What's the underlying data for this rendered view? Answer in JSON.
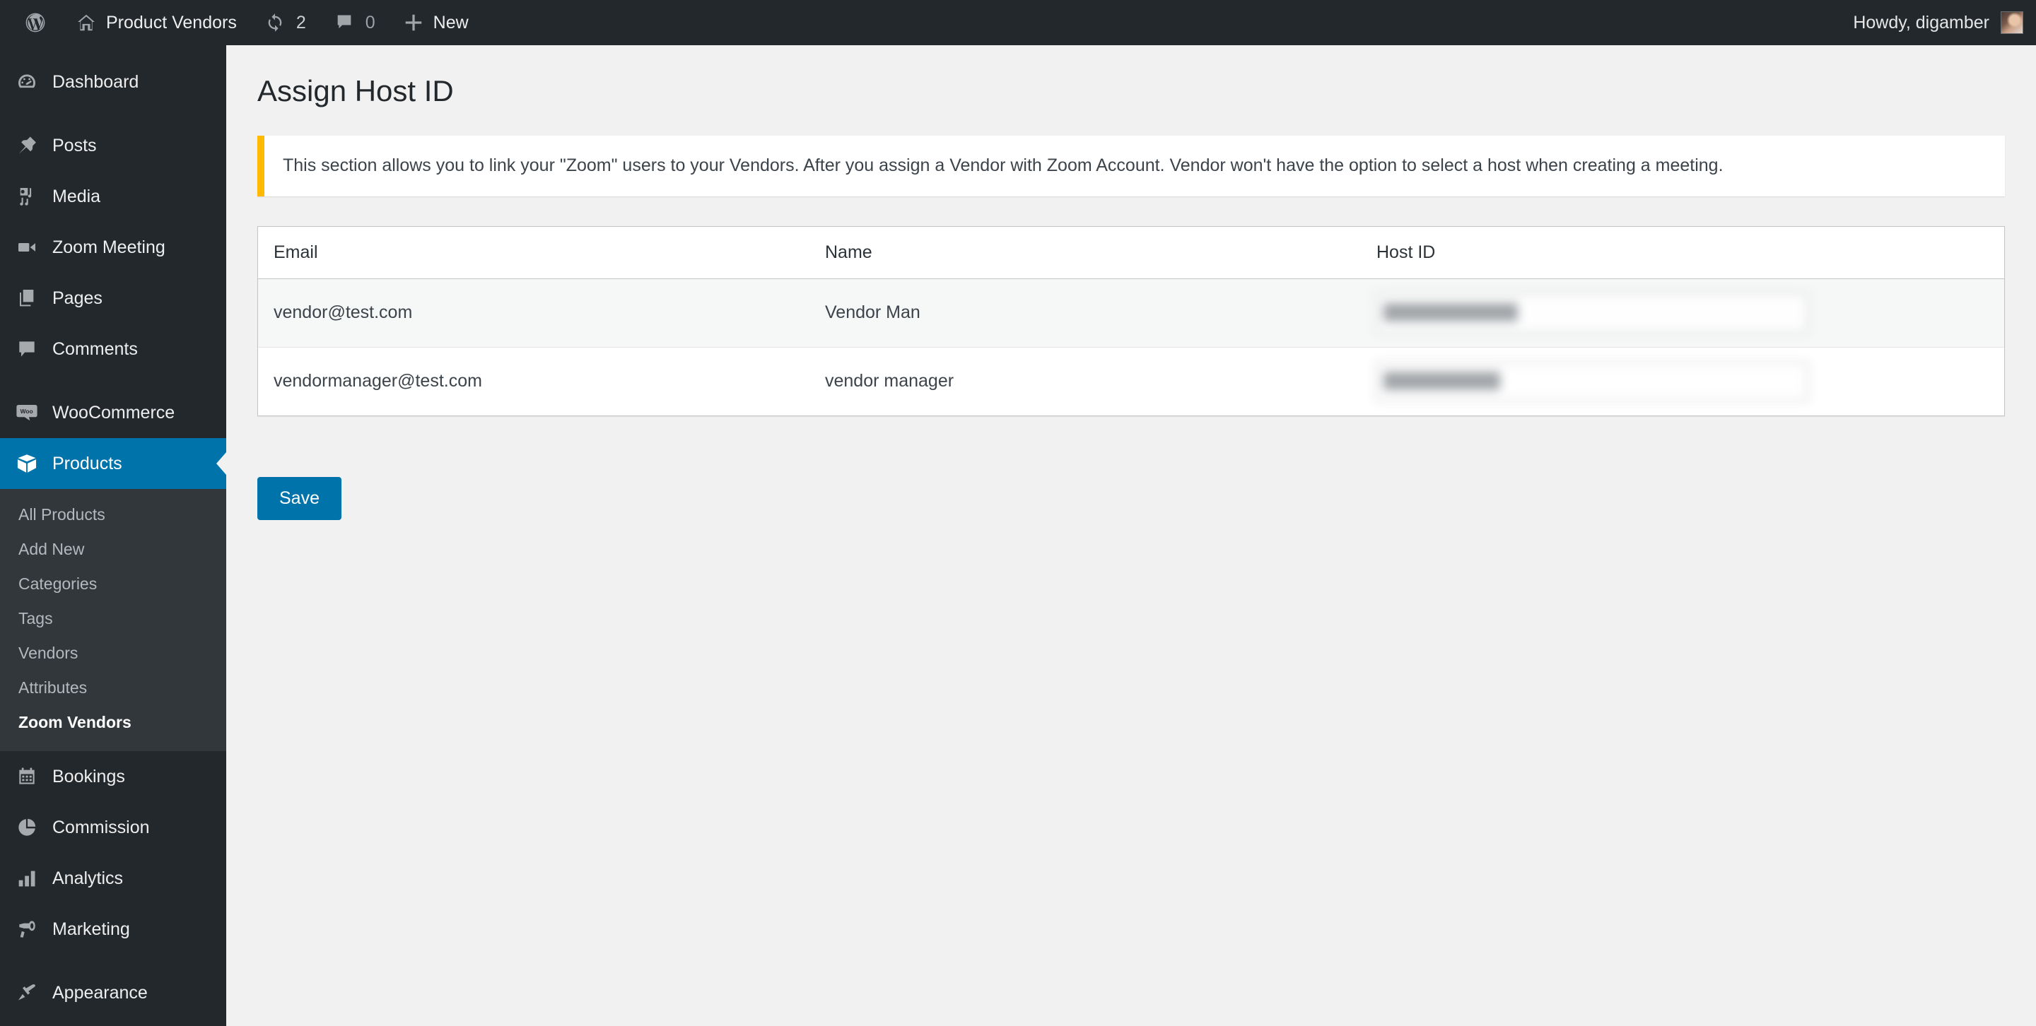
{
  "adminbar": {
    "site_name": "Product Vendors",
    "updates_count": "2",
    "comments_count": "0",
    "new_label": "New",
    "howdy": "Howdy, digamber",
    "icons": {
      "wordpress": "wordpress-logo-icon",
      "home": "home-icon",
      "updates": "updates-icon",
      "comments": "comment-bubble-icon",
      "new": "plus-icon",
      "avatar": "user-avatar"
    }
  },
  "sidebar": {
    "items": [
      {
        "label": "Dashboard",
        "icon": "dashboard-icon",
        "current": false,
        "separator_after": true
      },
      {
        "label": "Posts",
        "icon": "pin-icon",
        "current": false,
        "separator_after": false
      },
      {
        "label": "Media",
        "icon": "media-icon",
        "current": false,
        "separator_after": false
      },
      {
        "label": "Zoom Meeting",
        "icon": "video-camera-icon",
        "current": false,
        "separator_after": false
      },
      {
        "label": "Pages",
        "icon": "pages-icon",
        "current": false,
        "separator_after": false
      },
      {
        "label": "Comments",
        "icon": "comment-bubble-icon",
        "current": false,
        "separator_after": true
      },
      {
        "label": "WooCommerce",
        "icon": "woocommerce-icon",
        "current": false,
        "separator_after": false
      },
      {
        "label": "Products",
        "icon": "products-box-icon",
        "current": true,
        "separator_after": false
      }
    ],
    "submenu": {
      "parent": "Products",
      "items": [
        {
          "label": "All Products",
          "current": false
        },
        {
          "label": "Add New",
          "current": false
        },
        {
          "label": "Categories",
          "current": false
        },
        {
          "label": "Tags",
          "current": false
        },
        {
          "label": "Vendors",
          "current": false
        },
        {
          "label": "Attributes",
          "current": false
        },
        {
          "label": "Zoom Vendors",
          "current": true
        }
      ]
    },
    "items_after": [
      {
        "label": "Bookings",
        "icon": "calendar-icon",
        "current": false,
        "separator_after": false
      },
      {
        "label": "Commission",
        "icon": "pie-chart-icon",
        "current": false,
        "separator_after": false
      },
      {
        "label": "Analytics",
        "icon": "bar-chart-icon",
        "current": false,
        "separator_after": false
      },
      {
        "label": "Marketing",
        "icon": "megaphone-icon",
        "current": false,
        "separator_after": true
      },
      {
        "label": "Appearance",
        "icon": "paintbrush-icon",
        "current": false,
        "separator_after": false
      }
    ]
  },
  "main": {
    "page_title": "Assign Host ID",
    "notice_text": "This section allows you to link your \"Zoom\" users to your Vendors. After you assign a Vendor with Zoom Account. Vendor won't have the option to select a host when creating a meeting.",
    "table": {
      "headers": [
        "Email",
        "Name",
        "Host ID"
      ],
      "rows": [
        {
          "email": "vendor@test.com",
          "name": "Vendor Man",
          "host_id": ""
        },
        {
          "email": "vendormanager@test.com",
          "name": "vendor manager",
          "host_id": ""
        }
      ]
    },
    "save_label": "Save"
  },
  "colors": {
    "admin_bar": "#23282d",
    "sidebar": "#23282d",
    "submenu": "#32373c",
    "accent_blue": "#0073aa",
    "notice_accent": "#ffb900",
    "content_bg": "#f1f1f1",
    "row_alt": "#f6f7f7"
  }
}
